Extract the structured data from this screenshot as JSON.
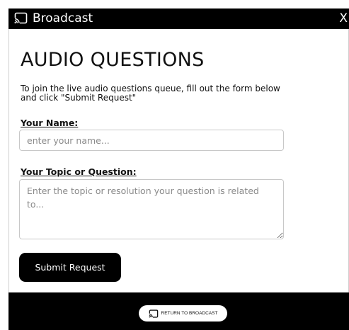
{
  "window": {
    "title": "Broadcast",
    "close_label": "X"
  },
  "form": {
    "heading": "AUDIO QUESTIONS",
    "intro": "To join the live audio questions queue, fill out the form below and click \"Submit Request\"",
    "name_label": "Your Name:",
    "name_value": "",
    "name_placeholder": "enter your name...",
    "topic_label": "Your Topic or Question:",
    "topic_value": "",
    "topic_placeholder": "Enter the topic or resolution your question is related to...",
    "submit_label": "Submit Request"
  },
  "footer": {
    "return_label": "RETURN TO BROADCAST"
  },
  "icons": {
    "titlebar": "cast-icon",
    "return": "cast-icon"
  },
  "colors": {
    "bar": "#000000",
    "panel": "#ffffff",
    "button": "#000000"
  }
}
